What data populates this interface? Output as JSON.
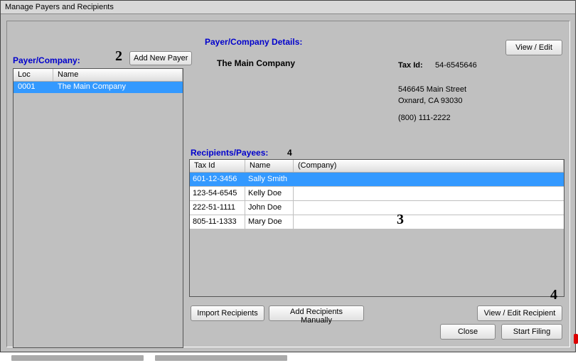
{
  "window": {
    "title": "Manage Payers and Recipients"
  },
  "labels": {
    "payer_company": "Payer/Company:",
    "details": "Payer/Company Details:",
    "recipients": "Recipients/Payees:",
    "taxid": "Tax Id:"
  },
  "buttons": {
    "add_new_payer": "Add New Payer",
    "view_edit": "View / Edit",
    "import_recipients": "Import Recipients",
    "add_recipients": "Add Recipients Manually",
    "view_edit_recipient": "View / Edit Recipient",
    "close": "Close",
    "start_filing": "Start Filing"
  },
  "step_labels": {
    "s2": "2",
    "s3": "3",
    "s4": "4"
  },
  "payer_table": {
    "headers": {
      "loc": "Loc",
      "name": "Name"
    },
    "rows": [
      {
        "loc": "0001",
        "name": "The Main Company"
      }
    ]
  },
  "selected_payer": {
    "name": "The Main Company",
    "taxid": "54-6545646",
    "addr1": "546645 Main Street",
    "addr2": "Oxnard, CA  93030",
    "phone": "(800) 111-2222"
  },
  "recipients_count": "4",
  "recipients_table": {
    "headers": {
      "taxid": "Tax Id",
      "name": "Name",
      "company": "(Company)"
    },
    "rows": [
      {
        "taxid": "601-12-3456",
        "name": "Sally  Smith",
        "company": ""
      },
      {
        "taxid": "123-54-6545",
        "name": "Kelly  Doe",
        "company": ""
      },
      {
        "taxid": "222-51-1111",
        "name": "John  Doe",
        "company": ""
      },
      {
        "taxid": "805-11-1333",
        "name": "Mary  Doe",
        "company": ""
      }
    ]
  }
}
